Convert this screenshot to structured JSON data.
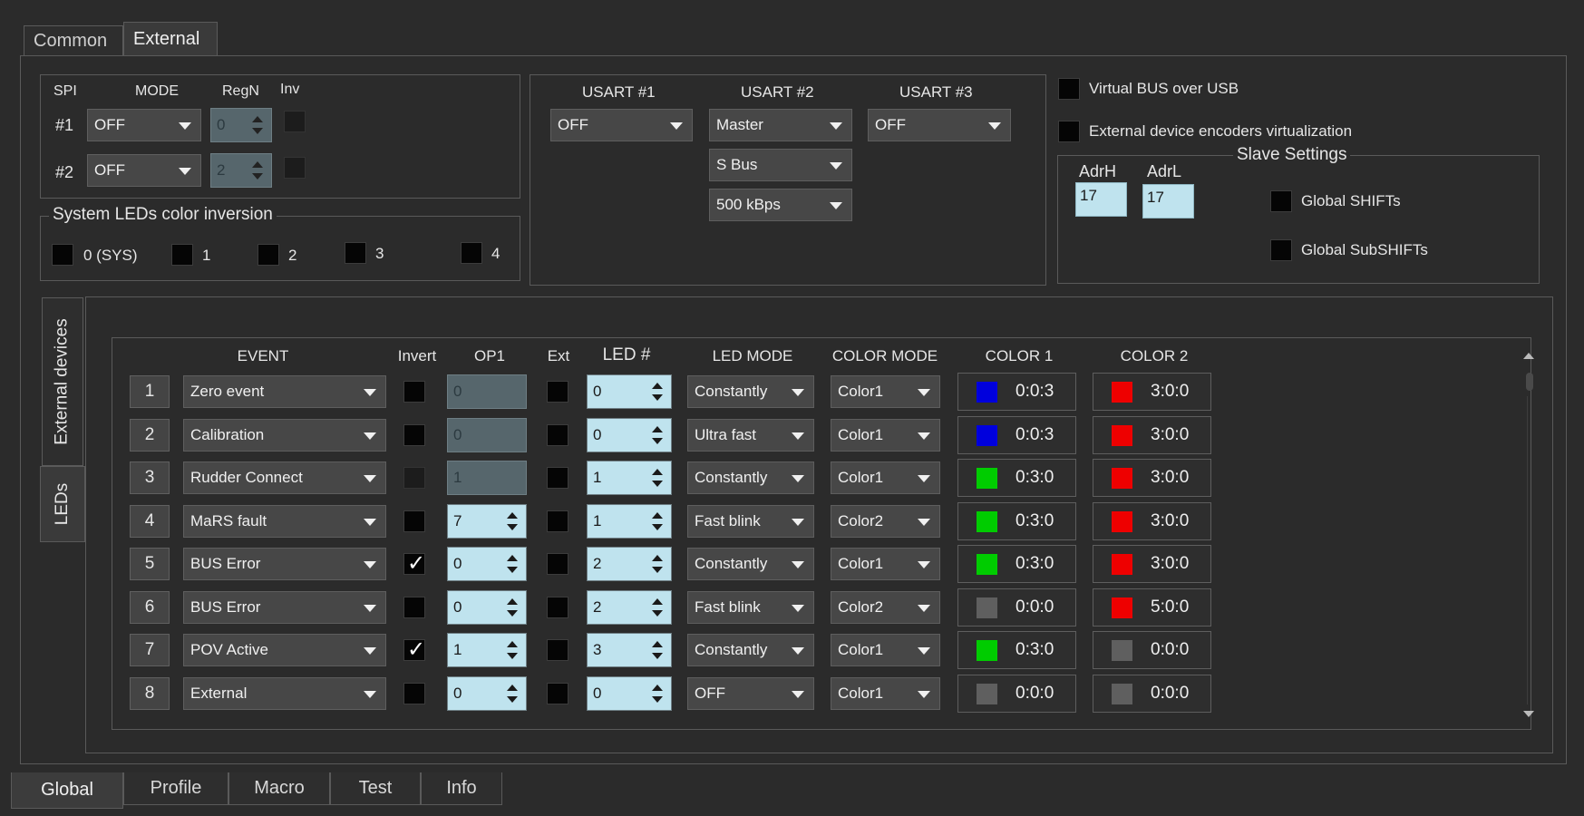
{
  "top_tabs": [
    "Common",
    "External"
  ],
  "bottom_tabs": [
    "Global",
    "Profile",
    "Macro",
    "Test",
    "Info"
  ],
  "spi": {
    "header_spi": "SPI",
    "header_mode": "MODE",
    "header_regn": "RegN",
    "header_inv": "Inv",
    "row1_label": "#1",
    "row1_mode": "OFF",
    "row1_regn": "0",
    "row2_label": "#2",
    "row2_mode": "OFF",
    "row2_regn": "2"
  },
  "sysleds": {
    "title": "System LEDs color inversion",
    "items": [
      "0 (SYS)",
      "1",
      "2",
      "3",
      "4"
    ]
  },
  "usart": {
    "u1_label": "USART #1",
    "u1_value": "OFF",
    "u2_label": "USART #2",
    "u2_value": "Master",
    "u2_proto": "S Bus",
    "u2_baud": "500 kBps",
    "u3_label": "USART #3",
    "u3_value": "OFF"
  },
  "virtual_bus": "Virtual BUS over USB",
  "encoders_virt": "External device encoders virtualization",
  "slave": {
    "title": "Slave Settings",
    "adrh_label": "AdrH",
    "adrh_value": "17",
    "adrl_label": "AdrL",
    "adrl_value": "17",
    "global_shifts": "Global SHIFTs",
    "global_subshifts": "Global SubSHIFTs"
  },
  "side_tabs": [
    "External devices",
    "LEDs"
  ],
  "led_table": {
    "headers": [
      "EVENT",
      "Invert",
      "OP1",
      "Ext",
      "LED #",
      "LED MODE",
      "COLOR MODE",
      "COLOR 1",
      "COLOR 2"
    ],
    "rows": [
      {
        "num": "1",
        "event": "Zero event",
        "invert": false,
        "invert_disabled": false,
        "op1": "0",
        "op1_disabled": true,
        "ext": false,
        "led": "0",
        "mode": "Constantly",
        "color_mode": "Color1",
        "c1": "0:0:3",
        "c1_color": "#0000dd",
        "c2": "3:0:0",
        "c2_color": "#ee0000"
      },
      {
        "num": "2",
        "event": "Calibration",
        "invert": false,
        "invert_disabled": false,
        "op1": "0",
        "op1_disabled": true,
        "ext": false,
        "led": "0",
        "mode": "Ultra fast",
        "color_mode": "Color1",
        "c1": "0:0:3",
        "c1_color": "#0000dd",
        "c2": "3:0:0",
        "c2_color": "#ee0000"
      },
      {
        "num": "3",
        "event": "Rudder Connect",
        "invert": false,
        "invert_disabled": true,
        "op1": "1",
        "op1_disabled": true,
        "ext": false,
        "led": "1",
        "mode": "Constantly",
        "color_mode": "Color1",
        "c1": "0:3:0",
        "c1_color": "#00cc00",
        "c2": "3:0:0",
        "c2_color": "#ee0000"
      },
      {
        "num": "4",
        "event": "MaRS fault",
        "invert": false,
        "invert_disabled": false,
        "op1": "7",
        "op1_disabled": false,
        "ext": false,
        "led": "1",
        "mode": "Fast blink",
        "color_mode": "Color2",
        "c1": "0:3:0",
        "c1_color": "#00cc00",
        "c2": "3:0:0",
        "c2_color": "#ee0000"
      },
      {
        "num": "5",
        "event": "BUS Error",
        "invert": true,
        "invert_disabled": false,
        "op1": "0",
        "op1_disabled": false,
        "ext": false,
        "led": "2",
        "mode": "Constantly",
        "color_mode": "Color1",
        "c1": "0:3:0",
        "c1_color": "#00cc00",
        "c2": "3:0:0",
        "c2_color": "#ee0000"
      },
      {
        "num": "6",
        "event": "BUS Error",
        "invert": false,
        "invert_disabled": false,
        "op1": "0",
        "op1_disabled": false,
        "ext": false,
        "led": "2",
        "mode": "Fast blink",
        "color_mode": "Color2",
        "c1": "0:0:0",
        "c1_color": "#5f5f5f",
        "c2": "5:0:0",
        "c2_color": "#ee0000"
      },
      {
        "num": "7",
        "event": "POV Active",
        "invert": true,
        "invert_disabled": false,
        "op1": "1",
        "op1_disabled": false,
        "ext": false,
        "led": "3",
        "mode": "Constantly",
        "color_mode": "Color1",
        "c1": "0:3:0",
        "c1_color": "#00cc00",
        "c2": "0:0:0",
        "c2_color": "#5f5f5f"
      },
      {
        "num": "8",
        "event": "External",
        "invert": false,
        "invert_disabled": false,
        "op1": "0",
        "op1_disabled": false,
        "ext": false,
        "led": "0",
        "mode": "OFF",
        "color_mode": "Color1",
        "c1": "0:0:0",
        "c1_color": "#5f5f5f",
        "c2": "0:0:0",
        "c2_color": "#5f5f5f"
      }
    ]
  }
}
